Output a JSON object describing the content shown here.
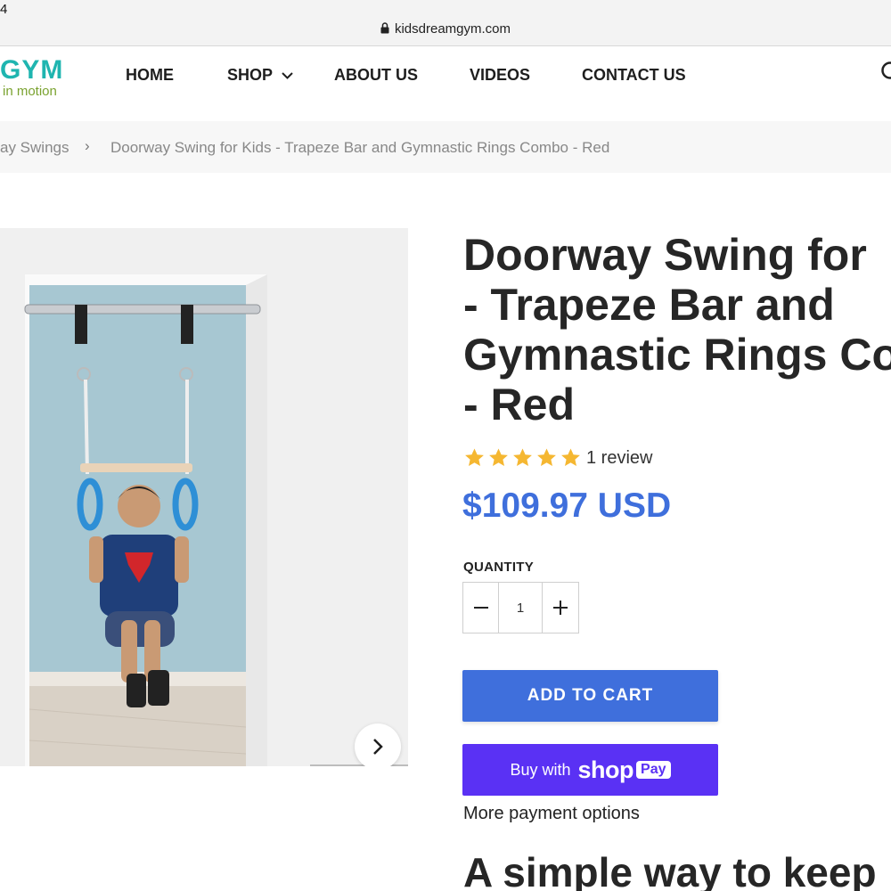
{
  "status_bar": {
    "time_fragment": "4"
  },
  "browser": {
    "url": "kidsdreamgym.com"
  },
  "header": {
    "logo_text": "GYM",
    "logo_tagline": "in motion",
    "nav": [
      {
        "label": "HOME"
      },
      {
        "label": "SHOP"
      },
      {
        "label": "ABOUT US"
      },
      {
        "label": "VIDEOS"
      },
      {
        "label": "CONTACT US"
      }
    ]
  },
  "breadcrumb": {
    "parent": "ay Swings",
    "separator": "›",
    "current": "Doorway Swing for Kids - Trapeze Bar and Gymnastic Rings Combo - Red"
  },
  "product": {
    "title_lines": [
      "Doorway Swing for",
      "- Trapeze Bar and",
      "Gymnastic Rings Co",
      "- Red"
    ],
    "rating": 5,
    "rating_max": 5,
    "review_count": "1 review",
    "price": "$109.97 USD",
    "quantity_label": "QUANTITY",
    "quantity": "1",
    "add_to_cart": "ADD TO CART",
    "buy_with_prefix": "Buy with",
    "shop_word": "shop",
    "pay_badge": "Pay",
    "more_payment": "More payment options",
    "section_heading": "A simple way to keep"
  },
  "colors": {
    "brand_teal": "#1fb5b0",
    "brand_green": "#7aa22f",
    "accent_blue": "#3f6fdc",
    "shop_pay_purple": "#5a31f4",
    "star": "#f5b731"
  }
}
